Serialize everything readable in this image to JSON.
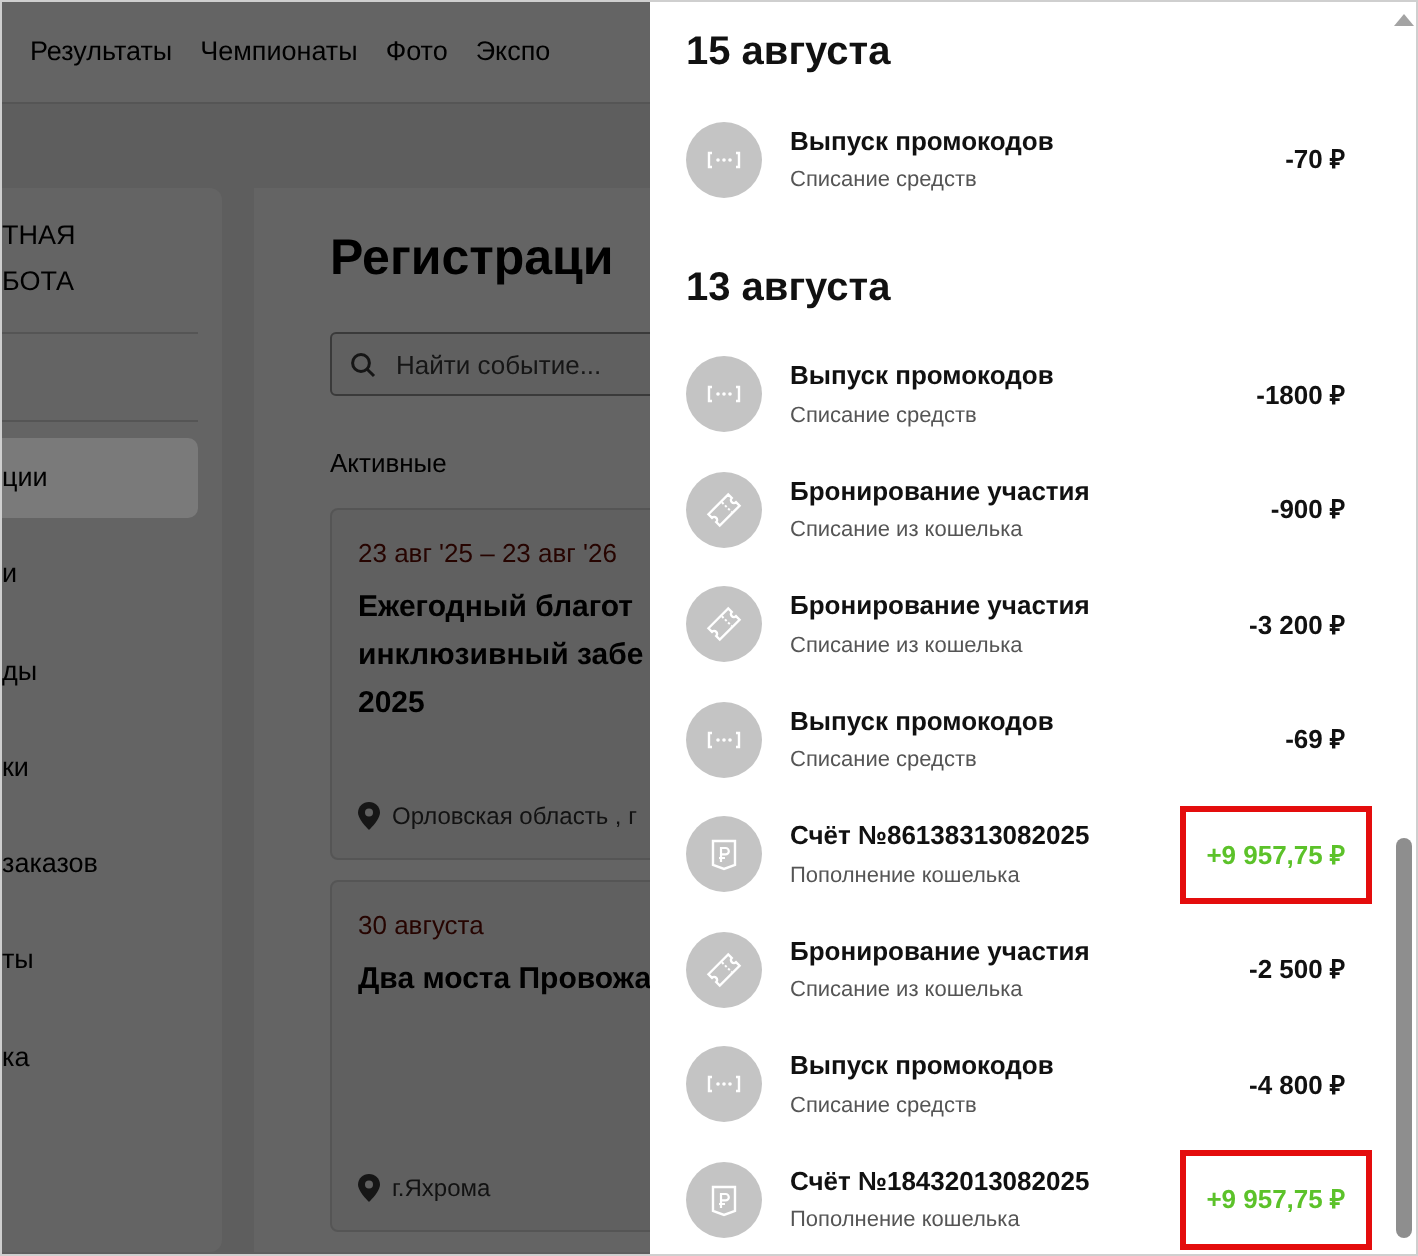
{
  "background_page": {
    "nav": [
      "Результаты",
      "Чемпионаты",
      "Фото",
      "Экспо"
    ],
    "sidebar": {
      "header_lines": [
        "ТНАЯ",
        "БОТА"
      ],
      "items": [
        {
          "label": "ции",
          "selected": true
        },
        {
          "label": "и",
          "selected": false
        },
        {
          "label": "ды",
          "selected": false
        },
        {
          "label": "ки",
          "selected": false
        },
        {
          "label": "заказов",
          "selected": false
        },
        {
          "label": "ты",
          "selected": false
        },
        {
          "label": "ка",
          "selected": false
        }
      ]
    },
    "main": {
      "title": "Регистраци",
      "search": {
        "placeholder": "Найти событие..."
      },
      "section": "Активные",
      "events": [
        {
          "date": "23 авг '25 – 23 авг '26",
          "title_lines": [
            "Ежегодный благот",
            "инклюзивный забе",
            "2025"
          ],
          "location": "Орловская область , г"
        },
        {
          "date": "30 августа",
          "title_lines": [
            "Два моста Провожа"
          ],
          "location": "г.Яхрома"
        }
      ]
    }
  },
  "transactions": [
    {
      "date": "15 августа",
      "items": [
        {
          "kind": "promo",
          "title": "Выпуск промокодов",
          "subtitle": "Списание средств",
          "amount": "-70 ₽",
          "positive": false,
          "highlighted": false
        }
      ]
    },
    {
      "date": "13 августа",
      "items": [
        {
          "kind": "promo",
          "title": "Выпуск промокодов",
          "subtitle": "Списание средств",
          "amount": "-1800 ₽",
          "positive": false,
          "highlighted": false
        },
        {
          "kind": "booking",
          "title": "Бронирование участия",
          "subtitle": "Списание из кошелька",
          "amount": "-900 ₽",
          "positive": false,
          "highlighted": false
        },
        {
          "kind": "booking",
          "title": "Бронирование участия",
          "subtitle": "Списание из кошелька",
          "amount": "-3 200 ₽",
          "positive": false,
          "highlighted": false
        },
        {
          "kind": "promo",
          "title": "Выпуск промокодов",
          "subtitle": "Списание средств",
          "amount": "-69 ₽",
          "positive": false,
          "highlighted": false
        },
        {
          "kind": "invoice",
          "title": "Счёт №86138313082025",
          "subtitle": "Пополнение кошелька",
          "amount": "+9 957,75 ₽",
          "positive": true,
          "highlighted": true
        },
        {
          "kind": "booking",
          "title": "Бронирование участия",
          "subtitle": "Списание из кошелька",
          "amount": "-2 500 ₽",
          "positive": false,
          "highlighted": false
        },
        {
          "kind": "promo",
          "title": "Выпуск промокодов",
          "subtitle": "Списание средств",
          "amount": "-4 800 ₽",
          "positive": false,
          "highlighted": false
        },
        {
          "kind": "invoice",
          "title": "Счёт №18432013082025",
          "subtitle": "Пополнение кошелька",
          "amount": "+9 957,75 ₽",
          "positive": true,
          "highlighted": true
        }
      ]
    }
  ]
}
